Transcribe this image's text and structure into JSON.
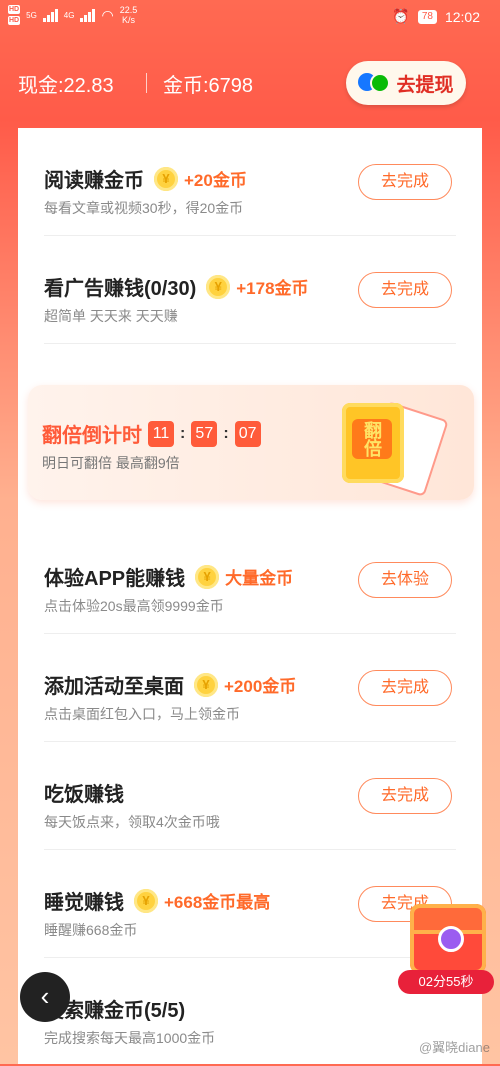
{
  "status_bar": {
    "hd1": "HD",
    "hd2": "HD",
    "net1": "5G",
    "net2": "4G",
    "speed": "22.5",
    "speed_unit": "K/s",
    "battery": "78",
    "time": "12:02"
  },
  "header": {
    "cash_label": "现金:22.83",
    "coins_label": "金币:6798",
    "withdraw_label": "去提现"
  },
  "tasks": [
    {
      "title": "阅读赚金币",
      "reward": "+20金币",
      "desc": "每看文章或视频30秒，得20金币",
      "button": "去完成",
      "has_coin": true
    },
    {
      "title": "看广告赚钱(0/30)",
      "reward": "+178金币",
      "desc": "超简单 天天来 天天赚",
      "button": "去完成",
      "has_coin": true
    },
    {
      "title": "体验APP能赚钱",
      "reward": "大量金币",
      "desc": "点击体验20s最高领9999金币",
      "button": "去体验",
      "has_coin": true
    },
    {
      "title": "添加活动至桌面",
      "reward": "+200金币",
      "desc": "点击桌面红包入口，马上领金币",
      "button": "去完成",
      "has_coin": true
    },
    {
      "title": "吃饭赚钱",
      "reward": "",
      "desc": "每天饭点来，领取4次金币哦",
      "button": "去完成",
      "has_coin": false
    },
    {
      "title": "睡觉赚钱",
      "reward": "+668金币最高",
      "desc": "睡醒赚668金币",
      "button": "去完成",
      "has_coin": true
    },
    {
      "title": "搜索赚金币(5/5)",
      "reward": "",
      "desc": "完成搜索每天最高1000金币",
      "button": "",
      "has_coin": false
    }
  ],
  "double": {
    "title": "翻倍倒计时",
    "hh": "11",
    "mm": "57",
    "ss": "07",
    "desc": "明日可翻倍 最高翻9倍",
    "badge": "翻倍"
  },
  "coin_symbol": "¥",
  "treasure": {
    "timer": "02分55秒"
  },
  "back_symbol": "‹",
  "watermark": "@翼晓diane",
  "colors": {
    "accent": "#ff5b49",
    "reward": "#ff6a2a",
    "withdraw_text": "#e02e24"
  }
}
